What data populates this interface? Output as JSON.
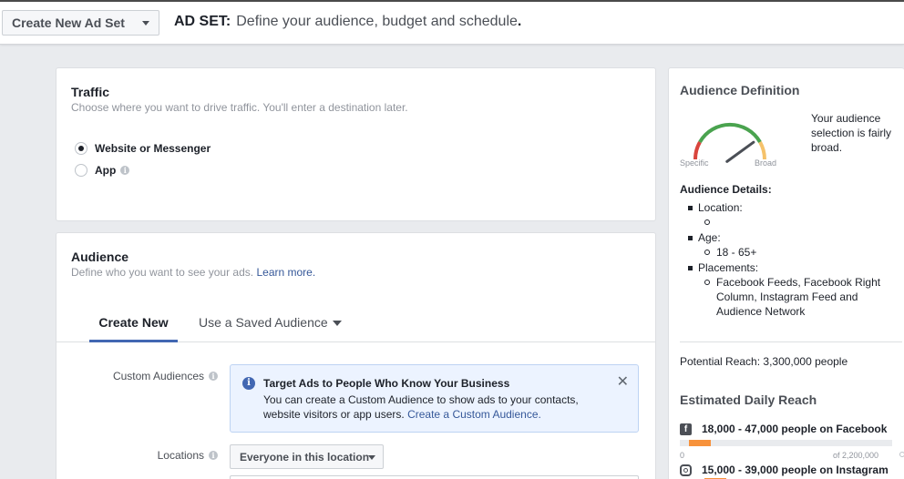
{
  "header": {
    "dropdown_label": "Create New Ad Set",
    "heading_strong": "AD SET:",
    "heading_desc": "Define your audience, budget and schedule",
    "heading_dot": "."
  },
  "traffic": {
    "title": "Traffic",
    "subtitle": "Choose where you want to drive traffic. You'll enter a destination later.",
    "options": [
      {
        "label": "Website or Messenger",
        "selected": true
      },
      {
        "label": "App",
        "selected": false
      }
    ]
  },
  "audience": {
    "title": "Audience",
    "subtitle": "Define who you want to see your ads.",
    "learn_more": "Learn more.",
    "tabs": {
      "create_new": "Create New",
      "saved": "Use a Saved Audience"
    },
    "custom_audiences_label": "Custom Audiences",
    "info_box": {
      "title": "Target Ads to People Who Know Your Business",
      "body": "You can create a Custom Audience to show ads to your contacts, website visitors or app users.",
      "link": "Create a Custom Audience."
    },
    "locations_label": "Locations",
    "locations_value": "Everyone in this location"
  },
  "audience_definition": {
    "title": "Audience Definition",
    "gauge_specific": "Specific",
    "gauge_broad": "Broad",
    "gauge_level": 0.8,
    "description": "Your audience selection is fairly broad.",
    "details_title": "Audience Details:",
    "location_label": "Location:",
    "location_value": "",
    "age_label": "Age:",
    "age_value": "18 - 65+",
    "placements_label": "Placements:",
    "placements_value": "Facebook Feeds, Facebook Right Column, Instagram Feed and Audience Network",
    "potential_reach": "Potential Reach: 3,300,000 people",
    "estimated_title": "Estimated Daily Reach",
    "facebook_reach": "18,000 - 47,000 people on Facebook",
    "bar_min": "0",
    "bar_max": "of 2,200,000",
    "instagram_reach": "15,000 - 39,000 people on Instagram",
    "colors": {
      "accent_orange": "#f7923b",
      "brand_blue": "#4267b2",
      "gauge_red": "#d9453d",
      "gauge_green": "#4aa34f",
      "gauge_yellow": "#f5c26b"
    }
  }
}
